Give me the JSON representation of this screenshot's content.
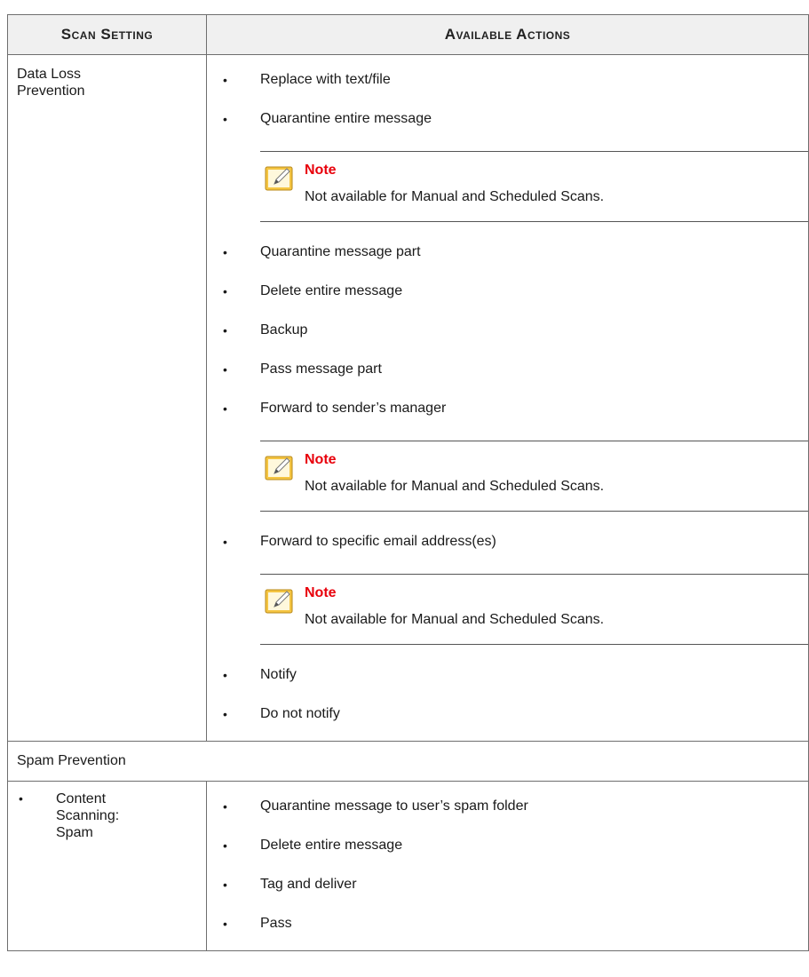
{
  "table": {
    "headers": [
      "Scan Setting",
      "Available Actions"
    ],
    "dlp": {
      "setting": "Data Loss Prevention",
      "actions": [
        "Replace with text/file",
        "Quarantine entire message",
        "Quarantine message part",
        "Delete entire message",
        "Backup",
        "Pass message part",
        "Forward to sender’s manager",
        "Forward to specific email address(es)",
        "Notify",
        "Do not notify"
      ],
      "note_title": "Note",
      "note_text": "Not available for Manual and Scheduled Scans."
    },
    "spam_section": "Spam Prevention",
    "spam": {
      "setting": "Content Scanning: Spam",
      "actions": [
        "Quarantine message to user’s spam folder",
        "Delete entire message",
        "Tag and deliver",
        "Pass"
      ]
    }
  },
  "bullet": "•",
  "icons": {
    "note": "note-pencil-icon"
  },
  "colors": {
    "note_title": "#e8000b",
    "header_bg": "#f0f0f0",
    "icon": "#f5c542"
  }
}
